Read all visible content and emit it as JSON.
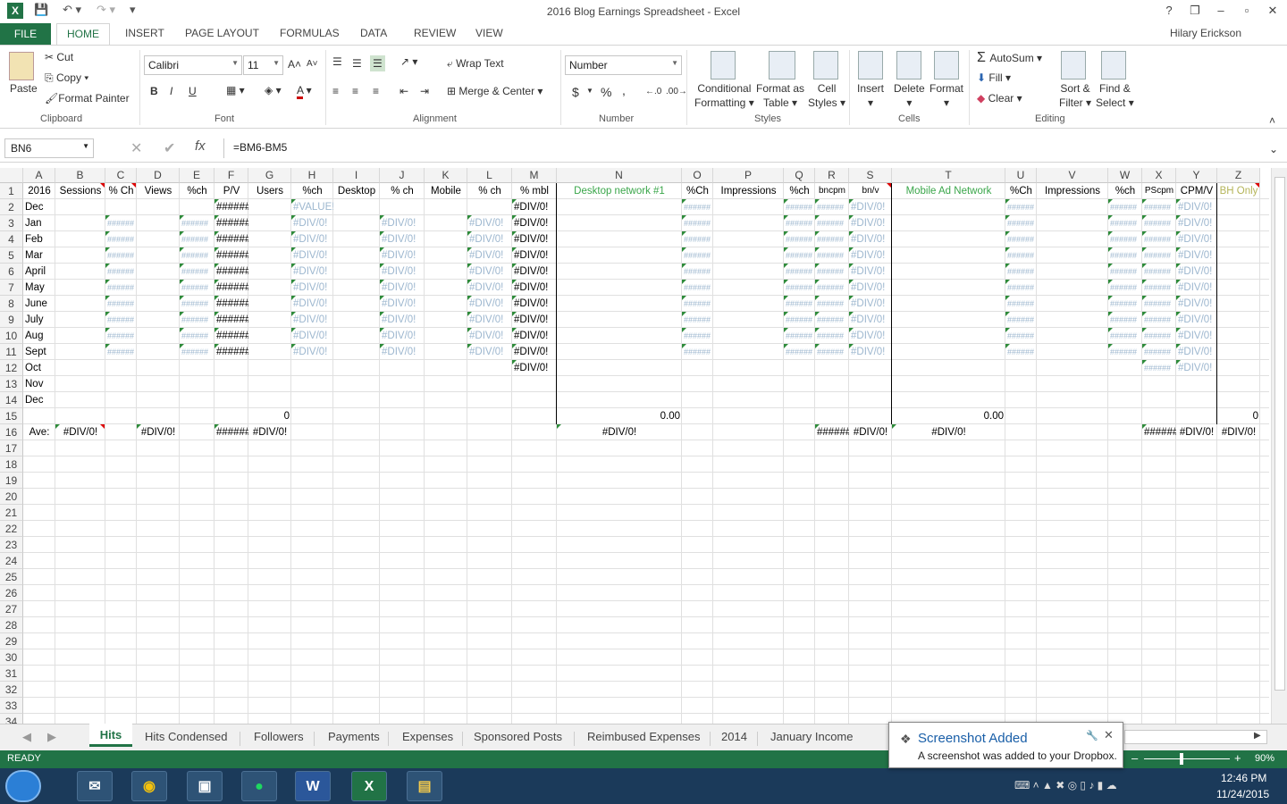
{
  "window": {
    "title": "2016 Blog Earnings Spreadsheet - Excel",
    "user": "Hilary Erickson",
    "help": "?",
    "min": "–",
    "restore": "❐",
    "close": "✕"
  },
  "ribbon_tabs": [
    "FILE",
    "HOME",
    "INSERT",
    "PAGE LAYOUT",
    "FORMULAS",
    "DATA",
    "REVIEW",
    "VIEW"
  ],
  "clipboard": {
    "paste": "Paste",
    "cut": "Cut",
    "copy": "Copy",
    "format_painter": "Format Painter",
    "group": "Clipboard"
  },
  "font": {
    "name": "Calibri",
    "size": "11",
    "bold": "B",
    "italic": "I",
    "underline": "U",
    "color": "A",
    "group": "Font"
  },
  "alignment": {
    "wrap": "Wrap Text",
    "merge": "Merge & Center",
    "group": "Alignment"
  },
  "number": {
    "format": "Number",
    "currency": "$",
    "percent": "%",
    "comma": ",",
    "group": "Number"
  },
  "styles": {
    "conditional1": "Conditional",
    "conditional2": "Formatting",
    "format_as1": "Format as",
    "format_as2": "Table",
    "cell1": "Cell",
    "cell2": "Styles",
    "group": "Styles"
  },
  "cells": {
    "insert": "Insert",
    "delete": "Delete",
    "format": "Format",
    "group": "Cells"
  },
  "editing": {
    "autosum": "AutoSum",
    "fill": "Fill",
    "clear": "Clear",
    "sort1": "Sort &",
    "sort2": "Filter",
    "find1": "Find &",
    "find2": "Select",
    "group": "Editing"
  },
  "formula_bar": {
    "name_box": "BN6",
    "formula": "=BM6-BM5",
    "fx": "fx"
  },
  "columns": [
    "A",
    "B",
    "C",
    "D",
    "E",
    "F",
    "G",
    "H",
    "I",
    "J",
    "K",
    "L",
    "M",
    "N",
    "O",
    "P",
    "Q",
    "R",
    "S",
    "T",
    "U",
    "V",
    "W",
    "X",
    "Y",
    "Z"
  ],
  "header_row": [
    "2016",
    "Sessions",
    "% Ch",
    "Views",
    "%ch",
    "P/V",
    "Users",
    "%ch",
    "Desktop",
    "% ch",
    "Mobile",
    "% ch",
    "% mbl",
    "Desktop network #1",
    "%Ch",
    "Impressions",
    "%ch",
    "bncpm",
    "bn/v",
    "Mobile Ad Network",
    "%Ch",
    "Impressions",
    "%ch",
    "PScpm",
    "CPM/V",
    "BH Only"
  ],
  "months": [
    "Dec",
    "Jan",
    "Feb",
    "Mar",
    "April",
    "May",
    "June",
    "July",
    "Aug",
    "Sept",
    "Oct",
    "Nov",
    "Dec"
  ],
  "errors": {
    "hash": "######",
    "div0": "#DIV/0!",
    "value": "#VALUE!"
  },
  "row15": {
    "g": "0",
    "n": "0.00",
    "t": "0.00",
    "z": "0"
  },
  "row16": {
    "a": "Ave:",
    "b": "#DIV/0!",
    "d": "#DIV/0!",
    "f": "######",
    "g": "#DIV/0!",
    "n": "#DIV/0!",
    "r": "######",
    "s": "#DIV/0!",
    "t": "#DIV/0!",
    "x": "######",
    "y": "#DIV/0!",
    "z": "#DIV/0!"
  },
  "sheet_tabs": [
    "Hits",
    "Hits Condensed",
    "Followers",
    "Payments",
    "Expenses",
    "Sponsored Posts",
    "Reimbused Expenses",
    "2014",
    "January Income"
  ],
  "status": {
    "ready": "READY",
    "zoom": "90%"
  },
  "toast": {
    "title": "Screenshot Added",
    "body": "A screenshot was added to your Dropbox."
  },
  "clock": {
    "time": "12:46 PM",
    "date": "11/24/2015"
  }
}
